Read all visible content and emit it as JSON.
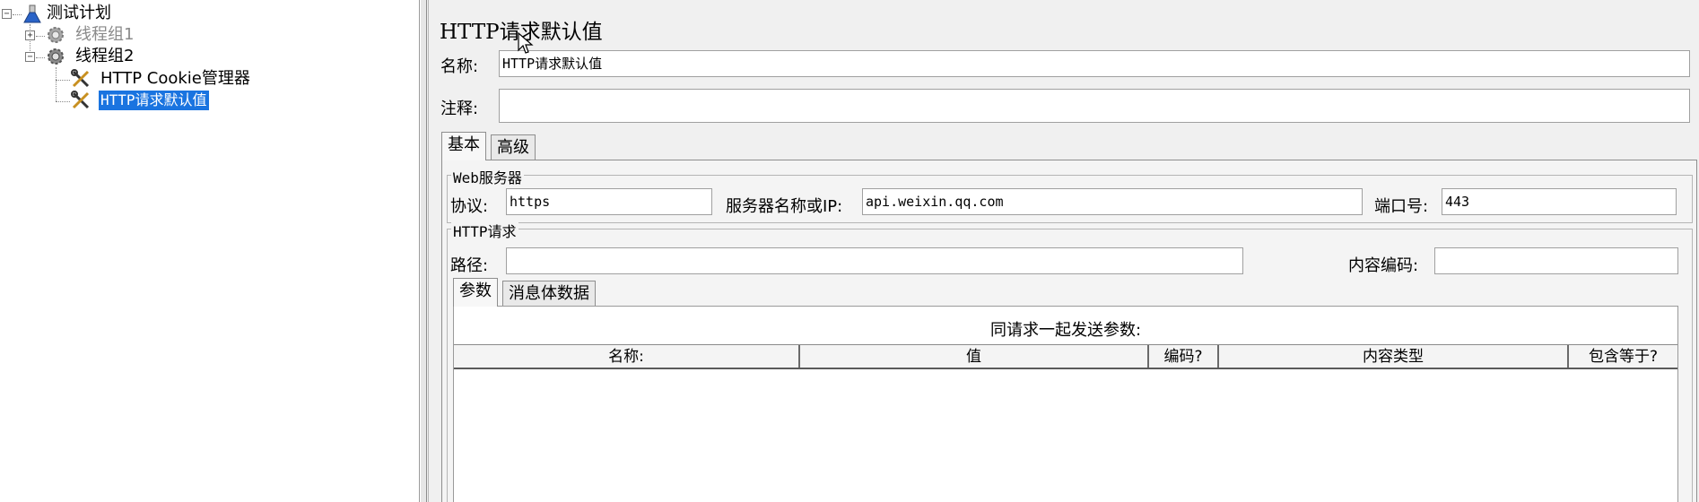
{
  "tree": {
    "root": {
      "label": "测试计划"
    },
    "nodes": [
      {
        "label": "线程组1",
        "enabled": false
      },
      {
        "label": "线程组2",
        "enabled": true
      }
    ],
    "children": [
      {
        "label": "HTTP Cookie管理器"
      },
      {
        "label": "HTTP请求默认值",
        "selected": true
      }
    ]
  },
  "panel": {
    "title": "HTTP请求默认值",
    "name_label": "名称:",
    "name_value": "HTTP请求默认值",
    "comment_label": "注释:",
    "comment_value": "",
    "tabs": [
      "基本",
      "高级"
    ],
    "web_server": {
      "title": "Web服务器",
      "protocol_label": "协议:",
      "protocol_value": "https",
      "server_label": "服务器名称或IP:",
      "server_value": "api.weixin.qq.com",
      "port_label": "端口号:",
      "port_value": "443"
    },
    "http_request": {
      "title": "HTTP请求",
      "path_label": "路径:",
      "path_value": "",
      "encoding_label": "内容编码:",
      "encoding_value": "",
      "tabs": [
        "参数",
        "消息体数据"
      ],
      "params_caption": "同请求一起发送参数:",
      "columns": [
        "名称:",
        "值",
        "编码?",
        "内容类型",
        "包含等于?"
      ]
    }
  }
}
